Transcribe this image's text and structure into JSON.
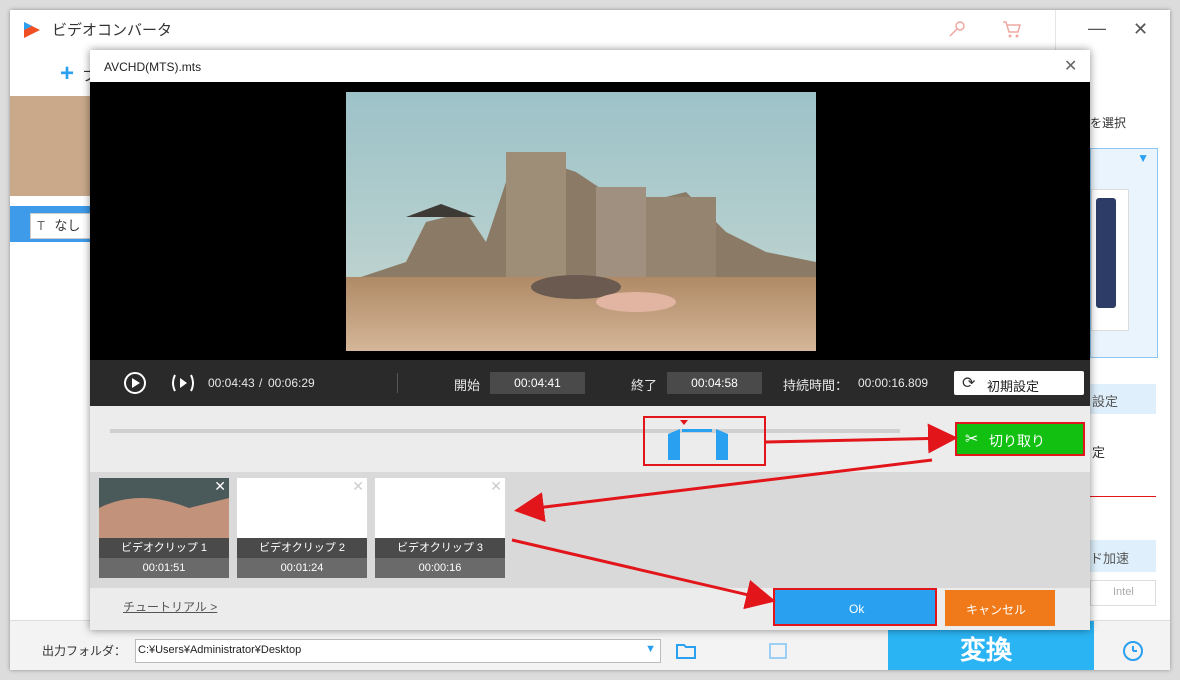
{
  "app": {
    "title": "ビデオコンバータ",
    "add_label": "+",
    "add_text": "フ",
    "subtitle_text": "なし",
    "right_labels": [
      "を選択",
      "設定",
      "定",
      "ド加速",
      "Intel"
    ],
    "output_label": "出力フォルダ：",
    "output_path": "C:¥Users¥Administrator¥Desktop",
    "convert_label": "変換"
  },
  "dialog": {
    "title": "AVCHD(MTS).mts",
    "current_time": "00:04:43",
    "time_separator": "/",
    "total_time": "00:06:29",
    "start_label": "開始",
    "start_value": "00:04:41",
    "end_label": "終了",
    "end_value": "00:04:58",
    "duration_label": "持続時間：",
    "duration_value": "00:00:16.809",
    "reset_label": "初期設定",
    "cut_label": "切り取り",
    "tutorial_label": "チュートリアル >",
    "ok_label": "Ok",
    "cancel_label": "キャンセル",
    "clips": [
      {
        "name": "ビデオクリップ 1",
        "duration": "00:01:51"
      },
      {
        "name": "ビデオクリップ 2",
        "duration": "00:01:24"
      },
      {
        "name": "ビデオクリップ 3",
        "duration": "00:00:16"
      }
    ]
  },
  "colors": {
    "accent_blue": "#2aa0f0",
    "cut_green": "#12c012",
    "cancel_orange": "#f07a1a",
    "highlight_red": "#e2151b"
  }
}
